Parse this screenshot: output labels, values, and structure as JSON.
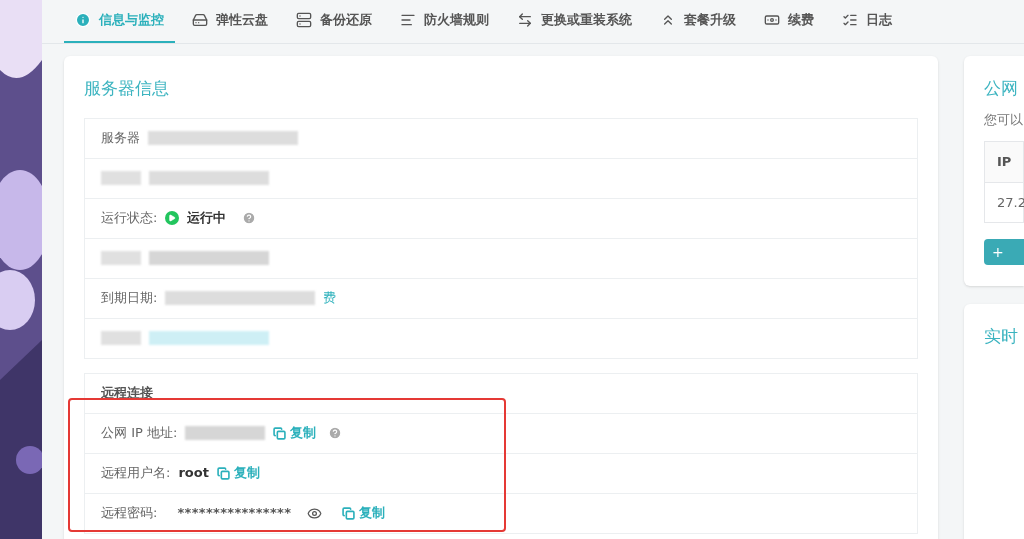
{
  "tabs": [
    {
      "label": "信息与监控",
      "selected": true
    },
    {
      "label": "弹性云盘",
      "selected": false
    },
    {
      "label": "备份还原",
      "selected": false
    },
    {
      "label": "防火墙规则",
      "selected": false
    },
    {
      "label": "更换或重装系统",
      "selected": false
    },
    {
      "label": "套餐升级",
      "selected": false
    },
    {
      "label": "续费",
      "selected": false
    },
    {
      "label": "日志",
      "selected": false
    }
  ],
  "server_info": {
    "title": "服务器信息",
    "rows": [
      {
        "kind": "redacted",
        "label": "服务器"
      },
      {
        "kind": "redacted"
      },
      {
        "kind": "status",
        "label": "运行状态:",
        "value": "运行中"
      },
      {
        "kind": "redacted"
      },
      {
        "kind": "redacted",
        "label": "到期日期:",
        "link": "费"
      },
      {
        "kind": "redacted"
      }
    ]
  },
  "remote": {
    "title": "远程连接",
    "rows": [
      {
        "kind": "ip",
        "label": "公网 IP 地址:",
        "copy": "复制"
      },
      {
        "kind": "user",
        "label": "远程用户名:",
        "value": "root",
        "copy": "复制"
      },
      {
        "kind": "password",
        "label": "远程密码:",
        "value": "****************",
        "copy": "复制"
      }
    ]
  },
  "side_card": {
    "title": "公网",
    "text": "您可以",
    "column": "IP",
    "cell": "27.2",
    "button": "+"
  },
  "side_card_2": {
    "title": "实时"
  }
}
